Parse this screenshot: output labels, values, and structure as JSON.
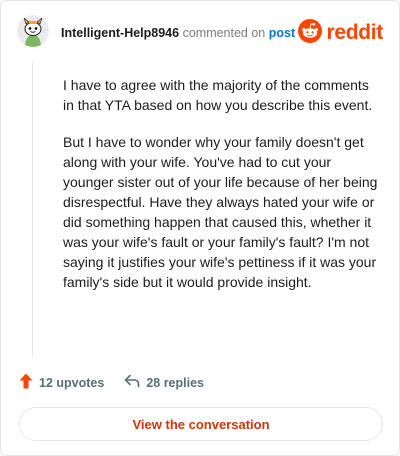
{
  "comment": {
    "username": "Intelligent-Help8946",
    "action_text": "commented on",
    "post_link": "post",
    "paragraphs": [
      "I have to agree with the majority of the comments in that YTA based on how you describe this event.",
      "But I have to wonder why your family doesn't get along with your wife. You've had to cut your younger sister out of your life because of her being disrespectful. Have they always hated your wife or did something happen that caused this, whether it was your wife's fault or your family's fault? I'm not saying it justifies your wife's pettiness if it was your family's side but it would provide insight."
    ]
  },
  "brand": {
    "name": "reddit",
    "color": "#ff4500"
  },
  "actions": {
    "upvotes_label": "12 upvotes",
    "replies_label": "28 replies"
  },
  "cta": {
    "label": "View the conversation"
  },
  "icons": {
    "avatar": "snoo-avatar-icon",
    "upvote": "upvote-arrow-icon",
    "reply": "reply-arrow-icon",
    "brand": "reddit-logo-icon"
  }
}
